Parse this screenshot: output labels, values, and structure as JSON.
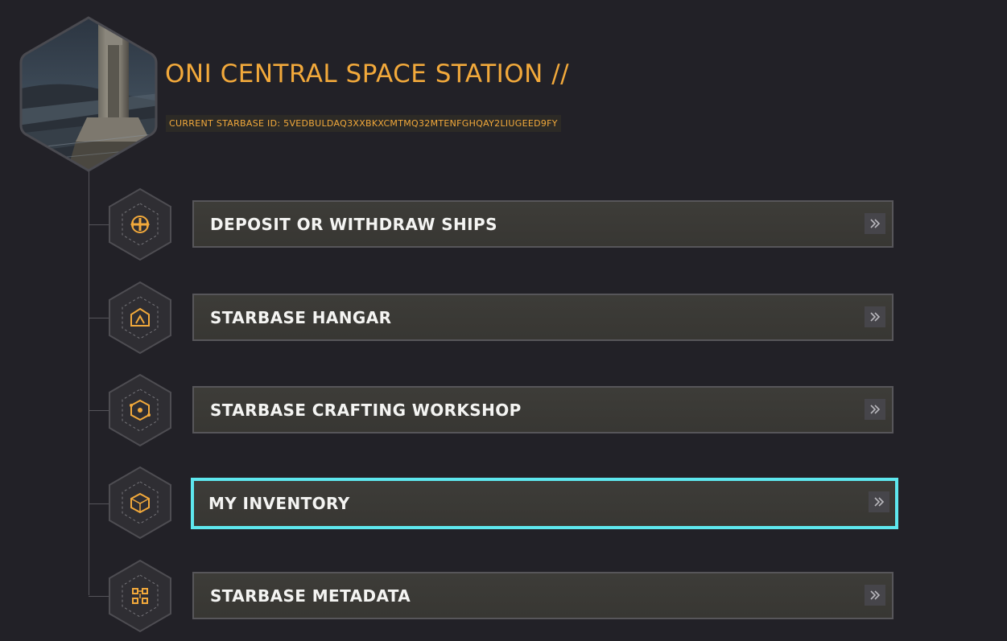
{
  "header": {
    "title": "ONI CENTRAL SPACE STATION //",
    "starbase_id": "CURRENT STARBASE ID: 5VEDBULDAQ3XXBKXCMTMQ32MTENFGHQAY2LIUGEED9FY"
  },
  "colors": {
    "accent": "#f2a93b",
    "background": "#222127",
    "button_bg": "#3a3935",
    "active_border": "#5ee7ee"
  },
  "menu": {
    "items": [
      {
        "label": "DEPOSIT OR WITHDRAW SHIPS",
        "icon": "ship-transfer-icon"
      },
      {
        "label": "STARBASE HANGAR",
        "icon": "hangar-icon"
      },
      {
        "label": "STARBASE CRAFTING WORKSHOP",
        "icon": "crafting-icon"
      },
      {
        "label": "MY INVENTORY",
        "icon": "inventory-icon",
        "active": true
      },
      {
        "label": "STARBASE METADATA",
        "icon": "metadata-icon"
      }
    ]
  }
}
